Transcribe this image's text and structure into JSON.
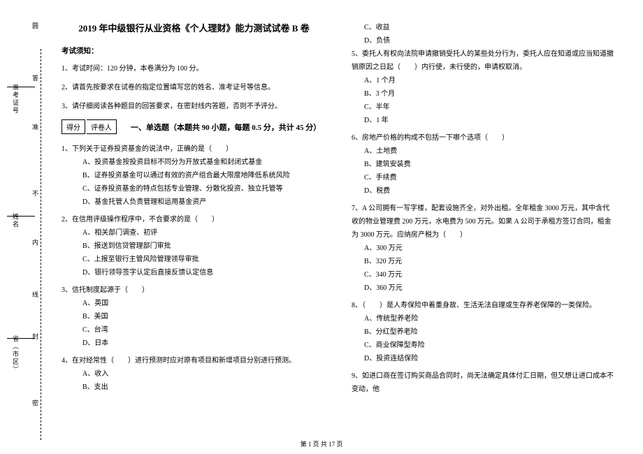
{
  "side": {
    "circle": "圆",
    "answer": "答",
    "admit_label": "准考证号",
    "admit": "准",
    "no": "不",
    "name_label": "姓名",
    "inner": "内",
    "line": "线",
    "seal": "封",
    "province_label": "省（市区）",
    "secret": "密"
  },
  "header": {
    "title": "2019 年中级银行从业资格《个人理财》能力测试试卷 B 卷",
    "notice_label": "考试须知：",
    "notice1": "1、考试时间：120 分钟，本卷满分为 100 分。",
    "notice2": "2、请首先按要求在试卷的指定位置填写您的姓名、准考证号等信息。",
    "notice3": "3、请仔细阅读各种题目的回答要求，在密封线内答题，否则不予评分。"
  },
  "score": {
    "score_label": "得分",
    "grader_label": "评卷人"
  },
  "section1": {
    "title": "一、单选题（本题共 90 小题，每题 0.5 分，共计 45 分）"
  },
  "q1": {
    "text": "1、下列关于证券投资基金的说法中，正确的是（　　）",
    "a": "A、投资基金按投资目标不同分为开放式基金和封闭式基金",
    "b": "B、证券投资基金可以通过有效的资产组合最大限度地降低系统风险",
    "c": "C、证券投资基金的特点包括专业管理、分散化投资、独立托管等",
    "d": "D、基金托管人负责管理和运用基金资产"
  },
  "q2": {
    "text": "2、在信用评级操作程序中，不合要求的是（　　）",
    "a": "A、相关部门调查、初评",
    "b": "B、报送到信贷管理部门审批",
    "c": "C、上报至银行主管风险管理领导审批",
    "d": "D、银行领导签字认定后直接反馈认定信息"
  },
  "q3": {
    "text": "3、信托制度起源于（　　）",
    "a": "A、英国",
    "b": "B、美国",
    "c": "C、台湾",
    "d": "D、日本"
  },
  "q4": {
    "text": "4、在对经常性（　　）进行预测时应对原有项目和新增项目分别进行预测。",
    "a": "A、收入",
    "b": "B、支出",
    "c": "C、收益",
    "d": "D、负债"
  },
  "q5": {
    "text": "5、委托人有权向法院申请撤销受托人的某些处分行为，委托人应在知道或应当知道撤销原因之日起（　　）内行使，未行使的，申请权取消。",
    "a": "A、1 个月",
    "b": "B、3 个月",
    "c": "C、半年",
    "d": "D、1 年"
  },
  "q6": {
    "text": "6、房地产价格的构成不包括一下哪个选项（　　）",
    "a": "A、土地费",
    "b": "B、建筑安装费",
    "c": "C、手续费",
    "d": "D、税费"
  },
  "q7": {
    "text": "7、A 公司拥有一写字楼，配套设施齐全，对外出租。全年租金 3000 万元，其中含代收的物业管理费 200 万元，水电费为 500 万元。如果 A 公司于承租方签订合同，租金为 3000 万元。应纳房产税为（　　）",
    "a": "A、300 万元",
    "b": "B、320 万元",
    "c": "C、340 万元",
    "d": "D、360 万元"
  },
  "q8": {
    "text": "8、（　　）是人寿保险中着重身故、生活无法自理或生存养老保障的一类保险。",
    "a": "A、传统型养老险",
    "b": "B、分红型养老险",
    "c": "C、商业保障型寿险",
    "d": "D、投资连结保险"
  },
  "q9": {
    "text": "9、如进口商在签订购买商品合同时，尚无法确定具体付汇日期，但又想让进口成本不变动，他"
  },
  "footer": {
    "text": "第 1 页 共 17 页"
  }
}
